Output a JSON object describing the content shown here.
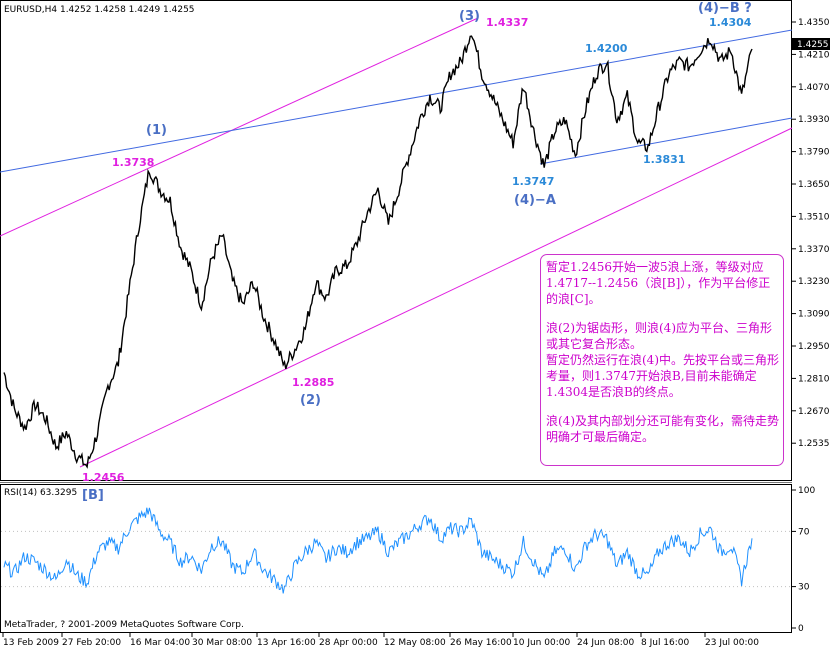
{
  "header": {
    "symbol_info": "EURUSD,H4  1.4252 1.4258 1.4249 1.4255",
    "rsi_title": "RSI(14) 63.3295",
    "copyright": "MetaTrader, ? 2001-2009 MetaQuotes Software Corp."
  },
  "price_axis": {
    "ticks": [
      "1.4350",
      "1.4210",
      "1.4070",
      "1.3930",
      "1.3790",
      "1.3650",
      "1.3510",
      "1.3370",
      "1.3230",
      "1.3090",
      "1.2950",
      "1.2810",
      "1.2670",
      "1.2535"
    ],
    "current_price": "1.4255"
  },
  "rsi_axis": {
    "ticks": [
      "100",
      "70",
      "30",
      "0"
    ]
  },
  "time_axis": {
    "labels": [
      "13 Feb 2009",
      "27 Feb 20:00",
      "16 Mar 04:00",
      "30 Mar 08:00",
      "13 Apr 16:00",
      "28 Apr 00:00",
      "12 May 08:00",
      "26 May 16:00",
      "10 Jun 00:00",
      "24 Jun 08:00",
      "8 Jul 16:00",
      "23 Jul 00:00"
    ]
  },
  "annotations": {
    "wave_1": "(1)",
    "wave_2": "(2)",
    "wave_3": "(3)",
    "wave_4a": "(4)−A",
    "wave_4b": "(4)−B ?",
    "wave_b": "[B]",
    "p_low": "1.2456",
    "p_1": "1.3738",
    "p_2": "1.2885",
    "p_3": "1.4337",
    "p_4a": "1.3747",
    "p_4200": "1.4200",
    "p_4304": "1.4304",
    "p_3831": "1.3831"
  },
  "comment": {
    "para1": "暂定1.2456开始一波5浪上涨，等级对应1.4717--1.2456（浪[B]），作为平台修正的浪[C]。",
    "para2": "浪(2)为锯齿形，则浪(4)应为平台、三角形或其它复合形态。",
    "para3": "暂定仍然运行在浪(4)中。先按平台或三角形考量，则1.3747开始浪B,目前未能确定1.4304是否浪B的终点。",
    "para4": "浪(4)及其内部划分还可能有变化，需待走势明确才可最后确定。"
  },
  "colors": {
    "price_line": "#000000",
    "rsi_line": "#1e90ff",
    "channel_magenta": "#e020e0",
    "channel_blue": "#4169e1",
    "label_magenta": "#e020e0",
    "label_blue": "#2b8ad8",
    "wave_label_blue": "#4a6fc4",
    "grid_frame": "#000000"
  },
  "chart_data": [
    {
      "type": "line",
      "title": "EURUSD,H4",
      "series": [
        {
          "name": "",
          "x": [
            "13 Feb 2009",
            "16 Feb 2009",
            "18 Feb 2009",
            "20 Feb 2009",
            "23 Feb 2009",
            "25 Feb 2009",
            "27 Feb 2009",
            "2 Mar 2009",
            "4 Mar 2009",
            "6 Mar 2009",
            "9 Mar 2009",
            "11 Mar 2009",
            "13 Mar 2009",
            "16 Mar 2009",
            "18 Mar 2009",
            "19 Mar 2009",
            "23 Mar 2009",
            "25 Mar 2009",
            "27 Mar 2009",
            "30 Mar 2009",
            "1 Apr 2009",
            "3 Apr 2009",
            "6 Apr 2009",
            "8 Apr 2009",
            "10 Apr 2009",
            "13 Apr 2009",
            "15 Apr 2009",
            "17 Apr 2009",
            "20 Apr 2009",
            "22 Apr 2009",
            "24 Apr 2009",
            "27 Apr 2009",
            "29 Apr 2009",
            "1 May 2009",
            "4 May 2009",
            "6 May 2009",
            "8 May 2009",
            "11 May 2009",
            "13 May 2009",
            "15 May 2009",
            "18 May 2009",
            "20 May 2009",
            "22 May 2009",
            "25 May 2009",
            "27 May 2009",
            "29 May 2009",
            "1 Jun 2009",
            "3 Jun 2009",
            "5 Jun 2009",
            "8 Jun 2009",
            "10 Jun 2009",
            "12 Jun 2009",
            "15 Jun 2009",
            "17 Jun 2009",
            "19 Jun 2009",
            "22 Jun 2009",
            "24 Jun 2009",
            "26 Jun 2009",
            "29 Jun 2009",
            "1 Jul 2009",
            "3 Jul 2009",
            "6 Jul 2009",
            "8 Jul 2009",
            "10 Jul 2009",
            "13 Jul 2009",
            "15 Jul 2009",
            "17 Jul 2009",
            "20 Jul 2009",
            "22 Jul 2009",
            "24 Jul 2009",
            "27 Jul 2009",
            "29 Jul 2009",
            "30 Jul 2009"
          ],
          "values": [
            1.286,
            1.27,
            1.262,
            1.272,
            1.266,
            1.254,
            1.26,
            1.25,
            1.2456,
            1.26,
            1.28,
            1.29,
            1.32,
            1.35,
            1.3738,
            1.365,
            1.36,
            1.34,
            1.33,
            1.315,
            1.335,
            1.345,
            1.325,
            1.315,
            1.325,
            1.31,
            1.3,
            1.2885,
            1.296,
            1.305,
            1.325,
            1.318,
            1.33,
            1.332,
            1.342,
            1.355,
            1.365,
            1.35,
            1.365,
            1.38,
            1.395,
            1.405,
            1.4,
            1.415,
            1.42,
            1.4337,
            1.415,
            1.405,
            1.395,
            1.385,
            1.41,
            1.39,
            1.3747,
            1.39,
            1.395,
            1.38,
            1.4,
            1.415,
            1.42,
            1.395,
            1.405,
            1.385,
            1.3831,
            1.4,
            1.415,
            1.42,
            1.418,
            1.425,
            1.4304,
            1.42,
            1.425,
            1.405,
            1.4255
          ]
        }
      ],
      "ylim": [
        1.244,
        1.441
      ]
    },
    {
      "type": "line",
      "title": "RSI(14) 63.3295",
      "series": [
        {
          "name": "",
          "x": [
            "13 Feb 2009",
            "16 Feb 2009",
            "18 Feb 2009",
            "20 Feb 2009",
            "23 Feb 2009",
            "25 Feb 2009",
            "27 Feb 2009",
            "2 Mar 2009",
            "4 Mar 2009",
            "6 Mar 2009",
            "9 Mar 2009",
            "11 Mar 2009",
            "13 Mar 2009",
            "16 Mar 2009",
            "18 Mar 2009",
            "19 Mar 2009",
            "23 Mar 2009",
            "25 Mar 2009",
            "27 Mar 2009",
            "30 Mar 2009",
            "1 Apr 2009",
            "3 Apr 2009",
            "6 Apr 2009",
            "8 Apr 2009",
            "10 Apr 2009",
            "13 Apr 2009",
            "15 Apr 2009",
            "17 Apr 2009",
            "20 Apr 2009",
            "22 Apr 2009",
            "24 Apr 2009",
            "27 Apr 2009",
            "29 Apr 2009",
            "1 May 2009",
            "4 May 2009",
            "6 May 2009",
            "8 May 2009",
            "11 May 2009",
            "13 May 2009",
            "15 May 2009",
            "18 May 2009",
            "20 May 2009",
            "22 May 2009",
            "25 May 2009",
            "27 May 2009",
            "29 May 2009",
            "1 Jun 2009",
            "3 Jun 2009",
            "5 Jun 2009",
            "8 Jun 2009",
            "10 Jun 2009",
            "12 Jun 2009",
            "15 Jun 2009",
            "17 Jun 2009",
            "19 Jun 2009",
            "22 Jun 2009",
            "24 Jun 2009",
            "26 Jun 2009",
            "29 Jun 2009",
            "1 Jul 2009",
            "3 Jul 2009",
            "6 Jul 2009",
            "8 Jul 2009",
            "10 Jul 2009",
            "13 Jul 2009",
            "15 Jul 2009",
            "17 Jul 2009",
            "20 Jul 2009",
            "22 Jul 2009",
            "24 Jul 2009",
            "27 Jul 2009",
            "29 Jul 2009",
            "30 Jul 2009"
          ],
          "values": [
            45,
            40,
            52,
            48,
            42,
            35,
            50,
            38,
            33,
            55,
            62,
            58,
            72,
            80,
            85,
            70,
            62,
            48,
            52,
            42,
            60,
            63,
            45,
            40,
            55,
            42,
            35,
            28,
            45,
            55,
            62,
            50,
            58,
            55,
            62,
            65,
            70,
            55,
            62,
            68,
            75,
            80,
            65,
            72,
            70,
            78,
            55,
            50,
            45,
            40,
            62,
            48,
            35,
            55,
            58,
            42,
            60,
            68,
            65,
            45,
            55,
            40,
            38,
            55,
            62,
            65,
            55,
            68,
            72,
            55,
            60,
            35,
            65
          ]
        }
      ],
      "ylim": [
        0,
        100
      ]
    }
  ]
}
